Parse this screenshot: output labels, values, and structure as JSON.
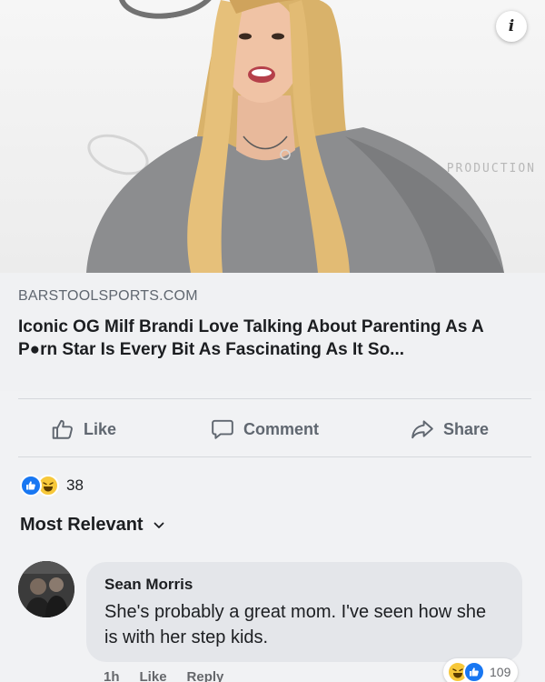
{
  "post": {
    "link_preview": {
      "backdrop_text": "EN PRODUCTION",
      "info_icon": "i"
    },
    "link": {
      "domain": "BARSTOOLSPORTS.COM",
      "title": "Iconic OG Milf Brandi Love Talking About Parenting As A P●rn Star Is Every Bit As Fascinating As It So..."
    },
    "actions": {
      "like": "Like",
      "comment": "Comment",
      "share": "Share"
    },
    "reactions": {
      "icons": [
        "like-icon",
        "haha-icon"
      ],
      "count": "38"
    }
  },
  "comments_section": {
    "sort_label": "Most Relevant",
    "comments": [
      {
        "author": "Sean Morris",
        "text": "She's probably a great mom. I've seen how she is with her step kids.",
        "time": "1h",
        "like_label": "Like",
        "reply_label": "Reply",
        "reaction_count": "109"
      }
    ]
  },
  "colors": {
    "accent": "#1877f2",
    "haha": "#f7c83a",
    "bubble": "#e4e6ea",
    "muted_text": "#606770"
  }
}
